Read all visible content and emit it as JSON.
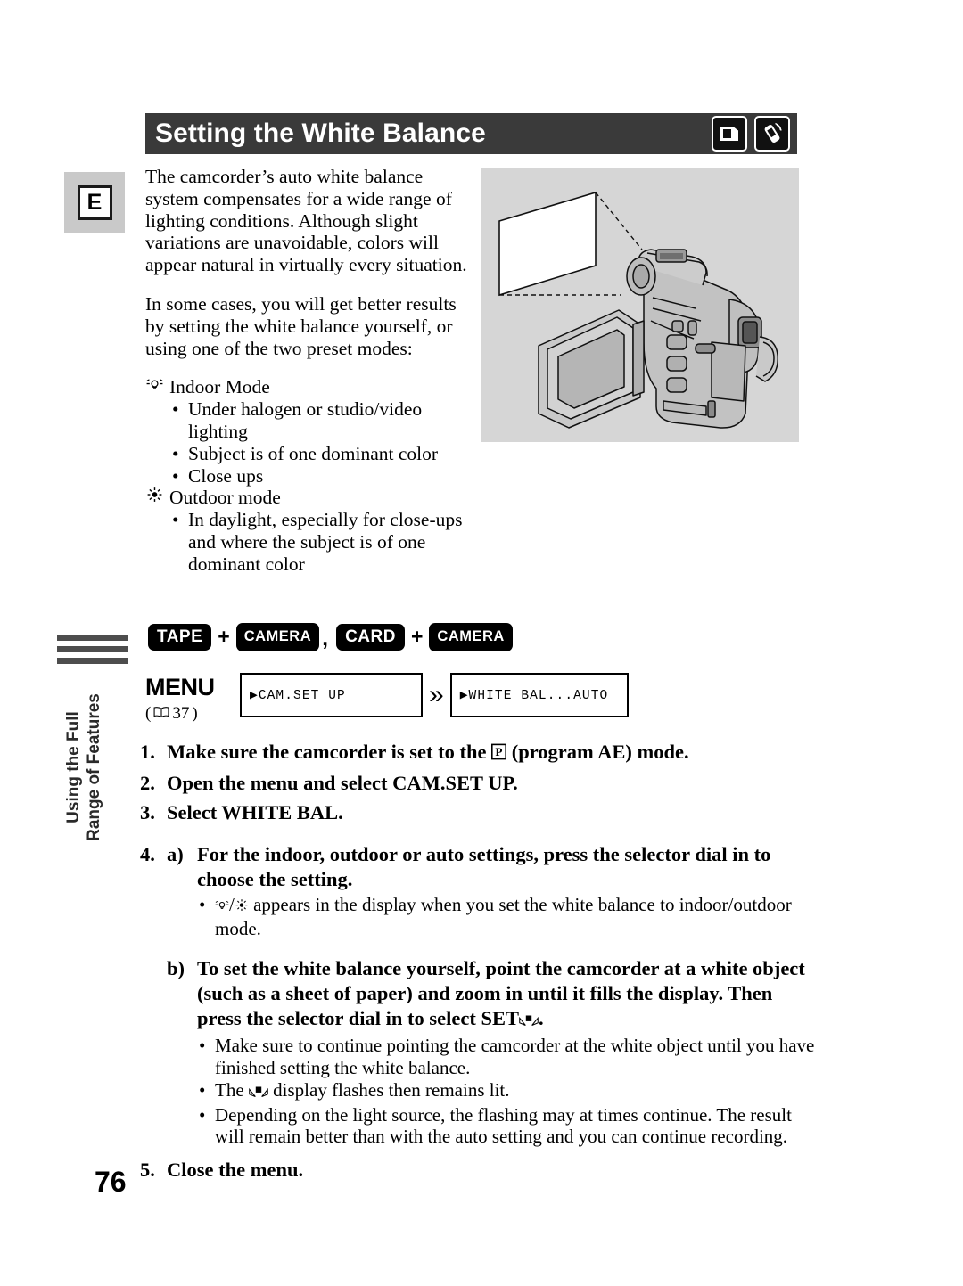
{
  "page": {
    "edition_marker": "E",
    "page_number": "76",
    "sidebar_label_line1": "Using the Full",
    "sidebar_label_line2": "Range of Features"
  },
  "header": {
    "title": "Setting the White Balance",
    "icons": [
      "card-tape-icon",
      "wireless-remote-icon"
    ]
  },
  "intro": {
    "paragraph1": "The camcorder’s auto white balance system compensates for a wide range of lighting conditions. Although slight variations are unavoidable, colors will appear natural in virtually every situation.",
    "paragraph2": "In some cases, you will get better results by setting the white balance yourself, or using one of the two preset modes:"
  },
  "modes": [
    {
      "icon": "indoor-lamp-icon",
      "label": "Indoor Mode",
      "bullets": [
        "Under halogen or studio/video lighting",
        "Subject is of one dominant color",
        "Close ups"
      ]
    },
    {
      "icon": "outdoor-sun-icon",
      "label": "Outdoor mode",
      "bullets": [
        "In daylight, especially for close-ups and where the subject is of one dominant color"
      ]
    }
  ],
  "keys": {
    "tape": "TAPE",
    "camera1": "CAMERA",
    "card": "CARD",
    "camera2": "CAMERA",
    "plus1": "+",
    "plus2": "+",
    "separator": ","
  },
  "menu": {
    "label": "MENU",
    "reference_open": "(",
    "reference_icon": "open-book-icon",
    "reference_page": "37",
    "reference_close": ")",
    "box1_text": "▶CAM.SET UP",
    "arrow": "»",
    "box2_text": "▶WHITE BAL...AUTO"
  },
  "steps": [
    {
      "num": "1.",
      "text_before": "Make sure the camcorder is set to the ",
      "icon": "program-ae-p-icon",
      "text_after": " (program AE) mode."
    },
    {
      "num": "2.",
      "text": "Open the menu and select CAM.SET UP."
    },
    {
      "num": "3.",
      "text": "Select WHITE BAL."
    }
  ],
  "step4": {
    "num": "4.",
    "a": {
      "letter": "a)",
      "text": "For the indoor, outdoor or auto settings, press the selector dial in to choose the setting.",
      "notes_prefix_icons": [
        "indoor-lamp-icon",
        "outdoor-sun-icon"
      ],
      "note_text": " appears in the display when you set the white balance to indoor/outdoor mode."
    },
    "b": {
      "letter": "b)",
      "text_before": "To set the white balance yourself, point the camcorder at a white object (such as a sheet of paper) and zoom in until it fills the display. Then press the selector dial in to select SET",
      "icon": "white-balance-set-icon",
      "text_after": ".",
      "notes": [
        {
          "text_before": "Make sure to continue pointing the camcorder at the white object until you have finished setting the white balance.",
          "icon": null,
          "text_after": ""
        },
        {
          "text_before": "The ",
          "icon": "white-balance-set-icon",
          "text_after": " display flashes then remains lit."
        },
        {
          "text_before": "Depending on the light source, the flashing may at times continue. The result will remain better than with the auto setting and you can continue recording.",
          "icon": null,
          "text_after": ""
        }
      ]
    }
  },
  "step5": {
    "num": "5.",
    "text": "Close the menu."
  },
  "illustration": {
    "name": "camcorder-pointing-at-white-paper",
    "background_color": "#d6d6d6",
    "description_elements": [
      "white-paper-sheet",
      "dashed-sight-lines",
      "camcorder-with-open-lcd"
    ]
  },
  "colors": {
    "header_bar": "#3a3a3a",
    "header_text": "#ffffff",
    "key_badge": "#000000",
    "sidebar_bars": "#4d4d4d",
    "e_block_bg": "#c9c9c9"
  }
}
